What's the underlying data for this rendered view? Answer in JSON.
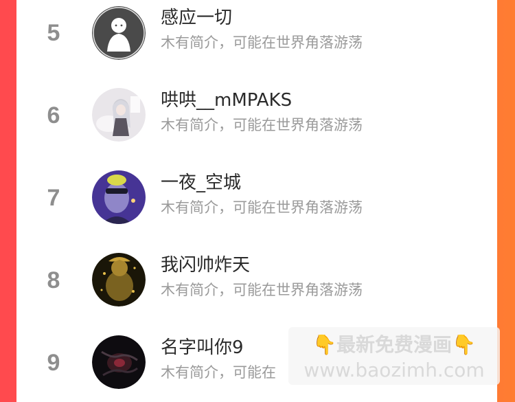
{
  "rows": [
    {
      "rank": "5",
      "name": "感应一切",
      "bio": "木有简介，可能在世界角落游荡"
    },
    {
      "rank": "6",
      "name": "哄哄__mMPAKS",
      "bio": "木有简介，可能在世界角落游荡"
    },
    {
      "rank": "7",
      "name": "一夜_空城",
      "bio": "木有简介，可能在世界角落游荡"
    },
    {
      "rank": "8",
      "name": "我闪帅炸天",
      "bio": "木有简介，可能在世界角落游荡"
    },
    {
      "rank": "9",
      "name": "名字叫你9",
      "bio": "木有简介，可能在"
    }
  ],
  "promo": {
    "title": "👇最新免费漫画👇",
    "url": "www.baozimh.com"
  }
}
